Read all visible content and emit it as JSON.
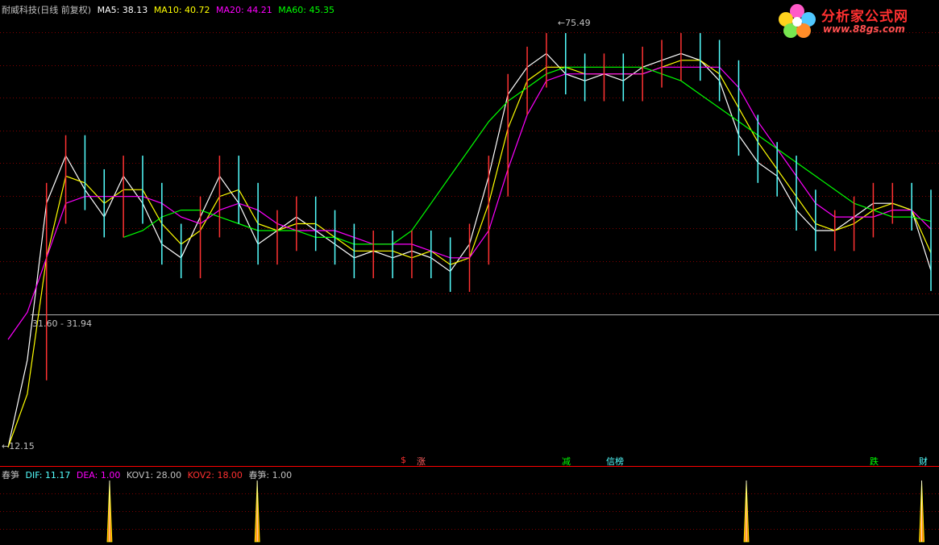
{
  "header": {
    "title": "耐威科技(日线 前复权)",
    "ma5_label": "MA5: 38.13",
    "ma10_label": "MA10: 40.72",
    "ma20_label": "MA20: 44.21",
    "ma60_label": "MA60: 45.35"
  },
  "colors": {
    "background": "#000000",
    "ma5": "#ffffff",
    "ma10": "#ffff00",
    "ma20": "#ff00ff",
    "ma60": "#00ff00",
    "candle_up": "#ff3232",
    "candle_down": "#54ffff",
    "grid": "#800000",
    "divider": "#ff0000",
    "logo_text": "#ff3030"
  },
  "price_labels": {
    "high": "75.49",
    "low": "12.15",
    "range": "31.60 - 31.94"
  },
  "signals": [
    {
      "text": "$",
      "color": "#ff3030"
    },
    {
      "text": "涨",
      "color": "#ff6060"
    },
    {
      "text": "减",
      "color": "#00ff00"
    },
    {
      "text": "信榜",
      "color": "#54ffff"
    },
    {
      "text": "跌",
      "color": "#00ff00"
    },
    {
      "text": "财",
      "color": "#54ffff"
    }
  ],
  "indicator": {
    "name": "春笋",
    "dif_label": "DIF: 11.17",
    "dea_label": "DEA: 1.00",
    "kov1_label": "KOV1: 28.00",
    "kov2_label": "KOV2: 18.00",
    "chunsun_label": "春笋: 1.00"
  },
  "logo": {
    "text": "分析家公式网",
    "url": "www.88gs.com"
  },
  "chart_data": {
    "type": "line",
    "title": "耐威科技(日线 前复权)",
    "ylim": [
      12.15,
      75.49
    ],
    "series": [
      {
        "name": "MA5",
        "values": [
          12.15,
          25,
          48,
          55,
          50,
          46,
          52,
          48,
          42,
          40,
          46,
          52,
          48,
          42,
          44,
          46,
          44,
          42,
          40,
          41,
          40,
          41,
          40,
          38,
          42,
          52,
          64,
          68,
          70,
          67,
          66,
          67,
          66,
          68,
          69,
          70,
          69,
          66,
          58,
          54,
          52,
          47,
          44,
          44,
          46,
          48,
          48,
          47,
          38.13
        ]
      },
      {
        "name": "MA10",
        "values": [
          12.15,
          20,
          40,
          52,
          51,
          48,
          50,
          50,
          45,
          42,
          44,
          49,
          50,
          45,
          44,
          45,
          45,
          43,
          41,
          41,
          41,
          40,
          41,
          39,
          40,
          48,
          59,
          66,
          68,
          68,
          67,
          67,
          67,
          67,
          68,
          69,
          69,
          67,
          62,
          57,
          53,
          49,
          45,
          44,
          45,
          47,
          48,
          47,
          40.72
        ]
      },
      {
        "name": "MA20",
        "values": [
          28,
          32,
          40,
          48,
          49,
          49,
          49,
          49,
          48,
          46,
          45,
          47,
          48,
          47,
          45,
          44,
          44,
          44,
          43,
          42,
          42,
          42,
          41,
          40,
          40,
          44,
          53,
          61,
          66,
          67,
          67,
          67,
          67,
          67,
          68,
          68,
          68,
          68,
          65,
          60,
          56,
          52,
          48,
          46,
          46,
          46,
          47,
          47,
          44.21
        ]
      },
      {
        "name": "MA60",
        "values": [
          null,
          null,
          null,
          null,
          null,
          null,
          43,
          44,
          46,
          47,
          47,
          46,
          45,
          44,
          44,
          44,
          43,
          43,
          42,
          42,
          42,
          44,
          48,
          52,
          56,
          60,
          63,
          65,
          67,
          68,
          68,
          68,
          68,
          68,
          67,
          66,
          64,
          62,
          60,
          58,
          56,
          54,
          52,
          50,
          48,
          47,
          46,
          46,
          45.35
        ]
      }
    ],
    "indicator_spikes": [
      0.11,
      0.27,
      0.8,
      0.99
    ]
  }
}
